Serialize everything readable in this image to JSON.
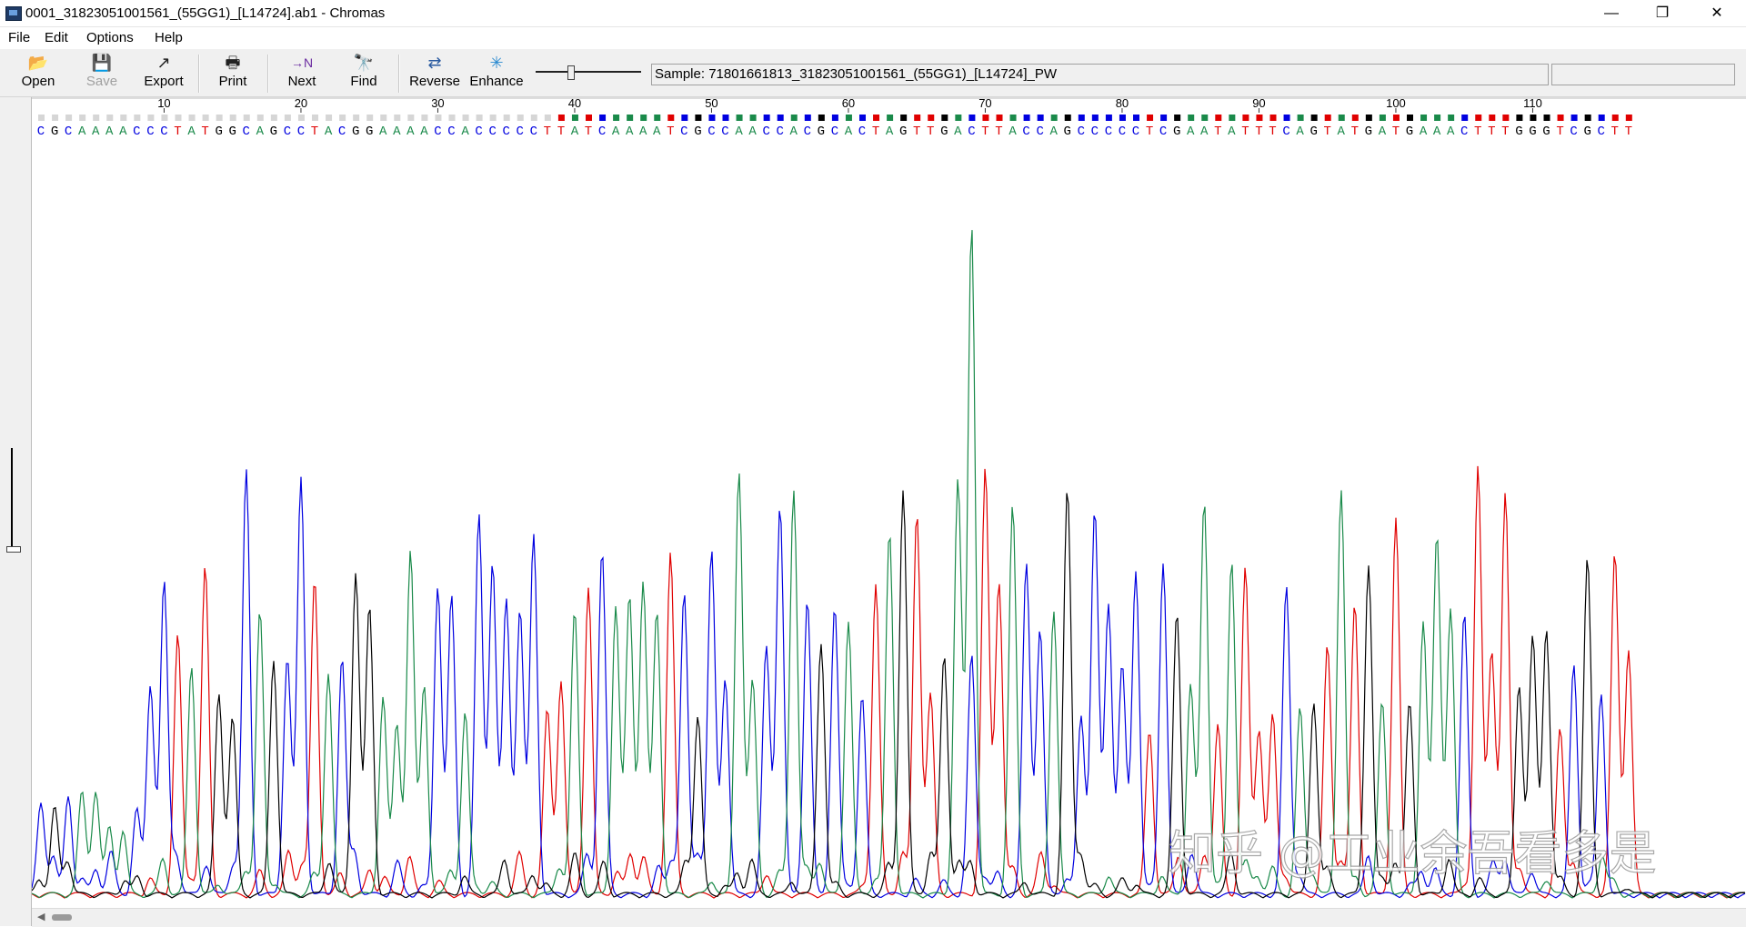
{
  "window": {
    "title": "0001_31823051001561_(55GG1)_[L14724].ab1 - Chromas",
    "controls": {
      "minimize": "—",
      "restore": "❐",
      "close": "✕"
    }
  },
  "menu": [
    "File",
    "Edit",
    "Options",
    "Help"
  ],
  "toolbar": {
    "buttons": [
      {
        "label": "Open",
        "icon": "folder-open-icon",
        "glyph": "📂",
        "enabled": true
      },
      {
        "label": "Save",
        "icon": "save-icon",
        "glyph": "💾",
        "enabled": false
      },
      {
        "label": "Export",
        "icon": "export-icon",
        "glyph": "↗",
        "enabled": true
      },
      {
        "label": "Print",
        "icon": "printer-icon",
        "glyph": "🖶",
        "enabled": true
      },
      {
        "label": "Next",
        "icon": "next-n-icon",
        "glyph": "→N",
        "enabled": true
      },
      {
        "label": "Find",
        "icon": "binoculars-icon",
        "glyph": "🔭",
        "enabled": true
      },
      {
        "label": "Reverse",
        "icon": "reverse-icon",
        "glyph": "⇄",
        "enabled": true
      },
      {
        "label": "Enhance",
        "icon": "enhance-sparkle-icon",
        "glyph": "✳",
        "enabled": true
      }
    ]
  },
  "sample": {
    "text": "Sample: 71801661813_31823051001561_(55GG1)_[L14724]_PW"
  },
  "sequence": {
    "bases": "CGCAAAACCCTATGGCAGCCTACGGAAAACCACCCCCTTATCAAAATCGCCAACCACGCACTAGTTGACTTACCAGCCCCCTCGAATATTTCAGTATGATGAAACTTTGGGTCGCTT",
    "ruler_labels": [
      "10",
      "20",
      "30",
      "40",
      "50",
      "60",
      "70",
      "80",
      "90",
      "100",
      "110"
    ],
    "colors": {
      "A": "#1a8a4a",
      "C": "#0000e0",
      "G": "#000000",
      "T": "#e00000"
    }
  },
  "watermark": {
    "text": "知乎 @工业余吾看多是"
  }
}
